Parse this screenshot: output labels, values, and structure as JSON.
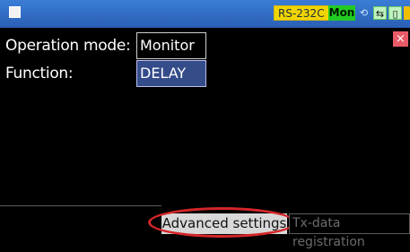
{
  "status_bar": {
    "port_badge": "RS-232C",
    "mode_badge": "Mon",
    "indicators": [
      "usb-icon",
      "green-link-icon",
      "green-save-icon",
      "battery-icon"
    ]
  },
  "form": {
    "operation_mode_label": "Operation mode:",
    "operation_mode_value": "Monitor",
    "function_label": "Function:",
    "function_value": "DELAY"
  },
  "controls": {
    "close_glyph": "×"
  },
  "tabs": {
    "advanced_label": "Advanced settings",
    "txdata_label": "Tx-data registration"
  },
  "colors": {
    "topbar": "#2a5fb3",
    "badge_rs": "#f0d400",
    "badge_mon": "#22cc22",
    "function_field_bg": "#344c8a",
    "close_btn": "#e85a67",
    "highlight_ring": "#d4262a"
  }
}
